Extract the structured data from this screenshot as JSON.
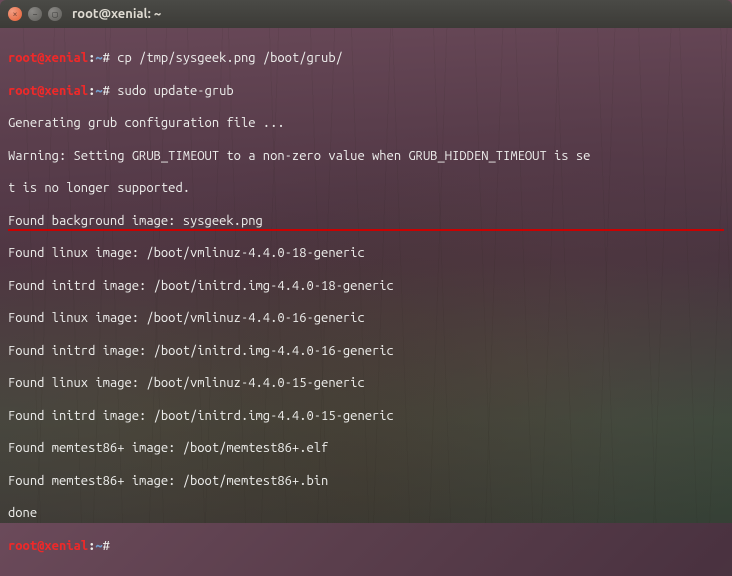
{
  "window": {
    "title": "root@xenial: ~"
  },
  "prompt": {
    "user": "root@xenial",
    "sep": ":",
    "path": "~",
    "hash": "#"
  },
  "commands": {
    "cmd1": "cp /tmp/sysgeek.png /boot/grub/",
    "cmd2": "sudo update-grub"
  },
  "output": {
    "l1": "Generating grub configuration file ...",
    "l2": "Warning: Setting GRUB_TIMEOUT to a non-zero value when GRUB_HIDDEN_TIMEOUT is se",
    "l3": "t is no longer supported.",
    "l4": "Found background image: sysgeek.png",
    "l5": "Found linux image: /boot/vmlinuz-4.4.0-18-generic",
    "l6": "Found initrd image: /boot/initrd.img-4.4.0-18-generic",
    "l7": "Found linux image: /boot/vmlinuz-4.4.0-16-generic",
    "l8": "Found initrd image: /boot/initrd.img-4.4.0-16-generic",
    "l9": "Found linux image: /boot/vmlinuz-4.4.0-15-generic",
    "l10": "Found initrd image: /boot/initrd.img-4.4.0-15-generic",
    "l11": "Found memtest86+ image: /boot/memtest86+.elf",
    "l12": "Found memtest86+ image: /boot/memtest86+.bin",
    "l13": "done"
  }
}
